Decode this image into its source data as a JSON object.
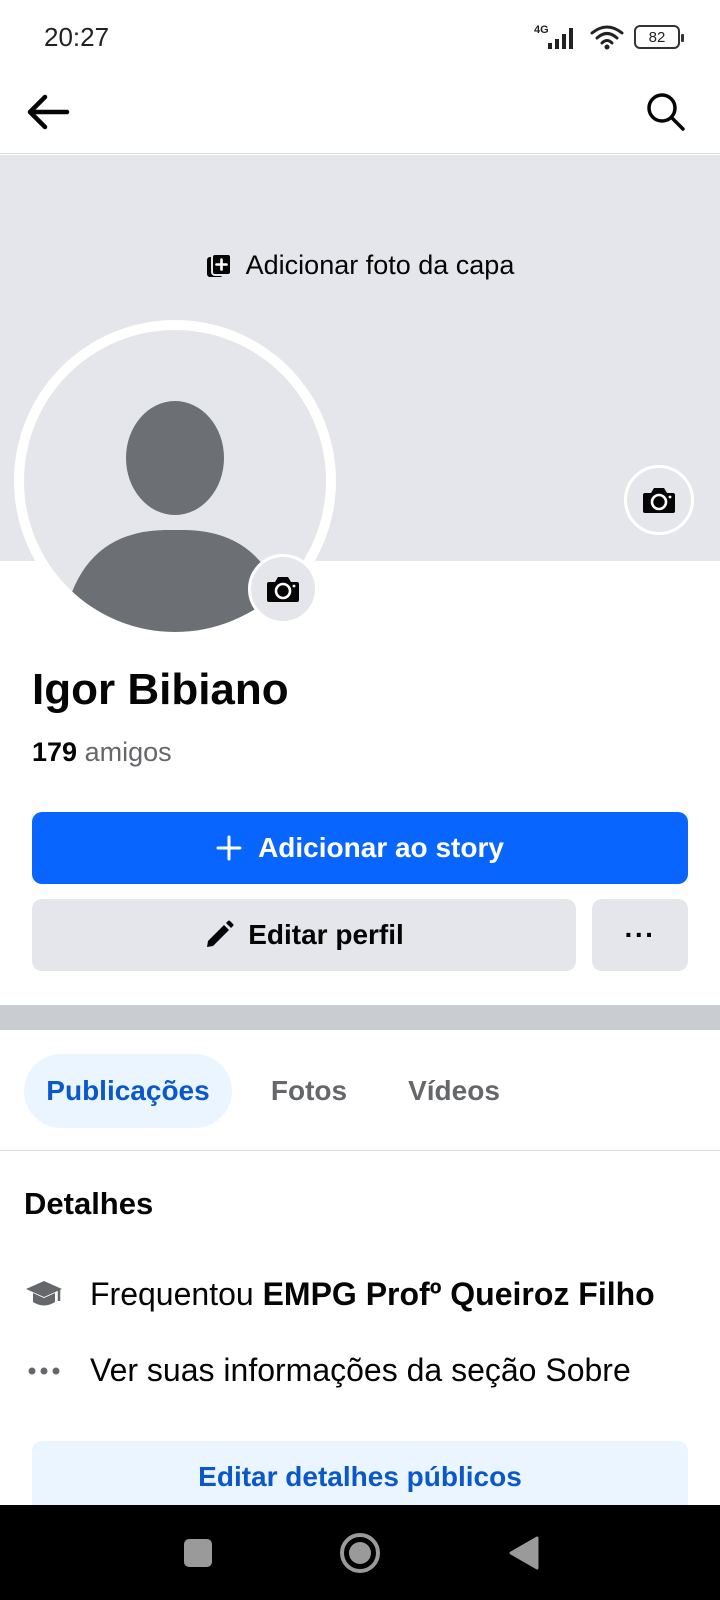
{
  "status": {
    "time": "20:27",
    "network": "4G",
    "battery": "82"
  },
  "appbar": {
    "back_icon": "arrow-left-icon",
    "search_icon": "search-icon"
  },
  "cover": {
    "add_cover_label": "Adicionar foto da capa"
  },
  "profile": {
    "name": "Igor Bibiano",
    "friends_count": "179",
    "friends_label": "amigos"
  },
  "actions": {
    "story_label": "Adicionar ao story",
    "edit_label": "Editar perfil",
    "more_label": "···"
  },
  "tabs": [
    {
      "label": "Publicações",
      "active": true
    },
    {
      "label": "Fotos",
      "active": false
    },
    {
      "label": "Vídeos",
      "active": false
    }
  ],
  "details": {
    "title": "Detalhes",
    "education_prefix": "Frequentou",
    "education_school": "EMPG Profº Queiroz Filho",
    "about_label": "Ver suas informações da seção Sobre",
    "edit_public_label": "Editar detalhes públicos"
  },
  "colors": {
    "accent": "#0866ff",
    "tab_active_bg": "#ebf5ff",
    "tab_active_text": "#0a58ca",
    "surface": "#e4e6eb"
  }
}
